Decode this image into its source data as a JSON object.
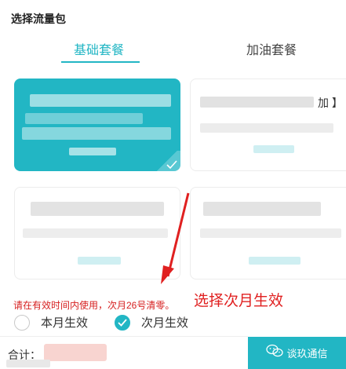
{
  "header": {
    "title": "选择流量包"
  },
  "tabs": [
    {
      "label": "基础套餐",
      "active": true
    },
    {
      "label": "加油套餐",
      "active": false
    }
  ],
  "cards": [
    {
      "selected": true,
      "text_visible": ""
    },
    {
      "selected": false,
      "text_visible": "加 】"
    },
    {
      "selected": false,
      "text_visible": ""
    },
    {
      "selected": false,
      "text_visible": ""
    }
  ],
  "annotation": {
    "text": "选择次月生效"
  },
  "notice": {
    "text": "请在有效时间内使用，次月26号清零。"
  },
  "effect_options": [
    {
      "label": "本月生效",
      "checked": false
    },
    {
      "label": "次月生效",
      "checked": true
    }
  ],
  "footer": {
    "total_label": "合计：",
    "pay_button_label": "谈玖通信"
  },
  "colors": {
    "accent": "#22b6c4",
    "annotation": "#e02020"
  }
}
